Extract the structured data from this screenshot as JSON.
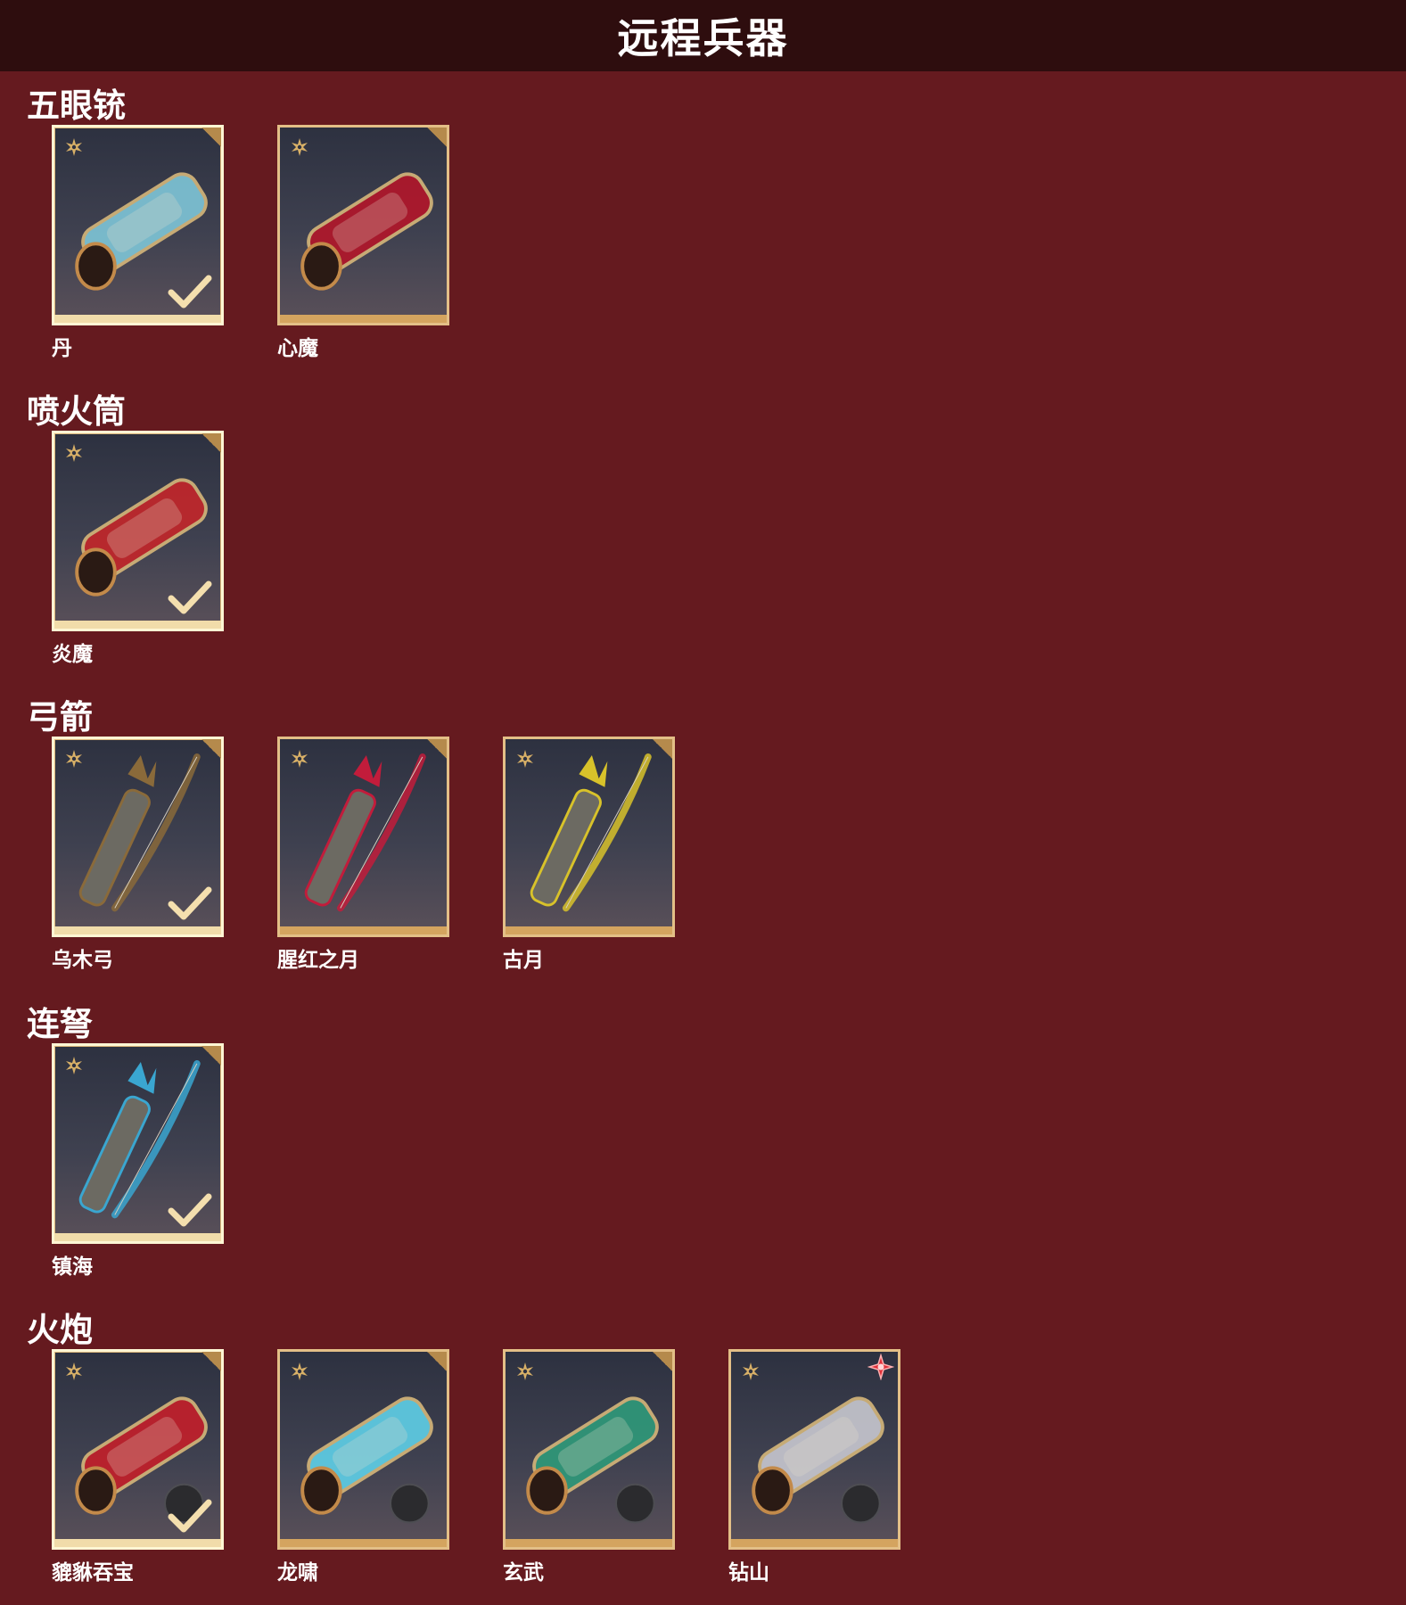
{
  "page": {
    "title": "远程兵器"
  },
  "colors": {
    "background": "#651a1f",
    "title_bar": "#2e0d0e",
    "card_border": "#e3bf87",
    "card_border_equipped": "#fff6d4",
    "star": "#d8b067",
    "new_badge": "#e0303a"
  },
  "categories": [
    {
      "title": "五眼铳",
      "items": [
        {
          "name": "丹",
          "equipped": true,
          "art": "blue-white-multi-barrel-gun",
          "accent": "#7fc6d8"
        },
        {
          "name": "心魔",
          "equipped": false,
          "art": "dark-red-demon-gun",
          "accent": "#b3162a"
        }
      ]
    },
    {
      "title": "喷火筒",
      "items": [
        {
          "name": "炎魔",
          "equipped": true,
          "art": "red-gold-fire-tube",
          "accent": "#c4262a"
        }
      ]
    },
    {
      "title": "弓箭",
      "items": [
        {
          "name": "乌木弓",
          "equipped": true,
          "art": "wooden-bow-and-quiver",
          "accent": "#8a6a3a"
        },
        {
          "name": "腥红之月",
          "equipped": false,
          "art": "crimson-bow-and-quiver",
          "accent": "#c21c3b"
        },
        {
          "name": "古月",
          "equipped": false,
          "art": "jade-bow-and-quiver",
          "accent": "#d8c22a"
        }
      ]
    },
    {
      "title": "连弩",
      "items": [
        {
          "name": "镇海",
          "equipped": true,
          "art": "silver-blue-repeating-crossbow",
          "accent": "#3aa6d0"
        }
      ]
    },
    {
      "title": "火炮",
      "items": [
        {
          "name": "貔貅吞宝",
          "equipped": true,
          "new": false,
          "art": "red-gold-cannon",
          "accent": "#c41f2a"
        },
        {
          "name": "龙啸",
          "equipped": false,
          "new": false,
          "art": "dragon-head-cannon",
          "accent": "#5fd0e8"
        },
        {
          "name": "玄武",
          "equipped": false,
          "new": false,
          "art": "green-serpent-cannon",
          "accent": "#2f9a7a"
        },
        {
          "name": "钻山",
          "equipped": false,
          "new": true,
          "art": "silver-drill-cannon",
          "accent": "#c8c8d0"
        }
      ]
    }
  ]
}
